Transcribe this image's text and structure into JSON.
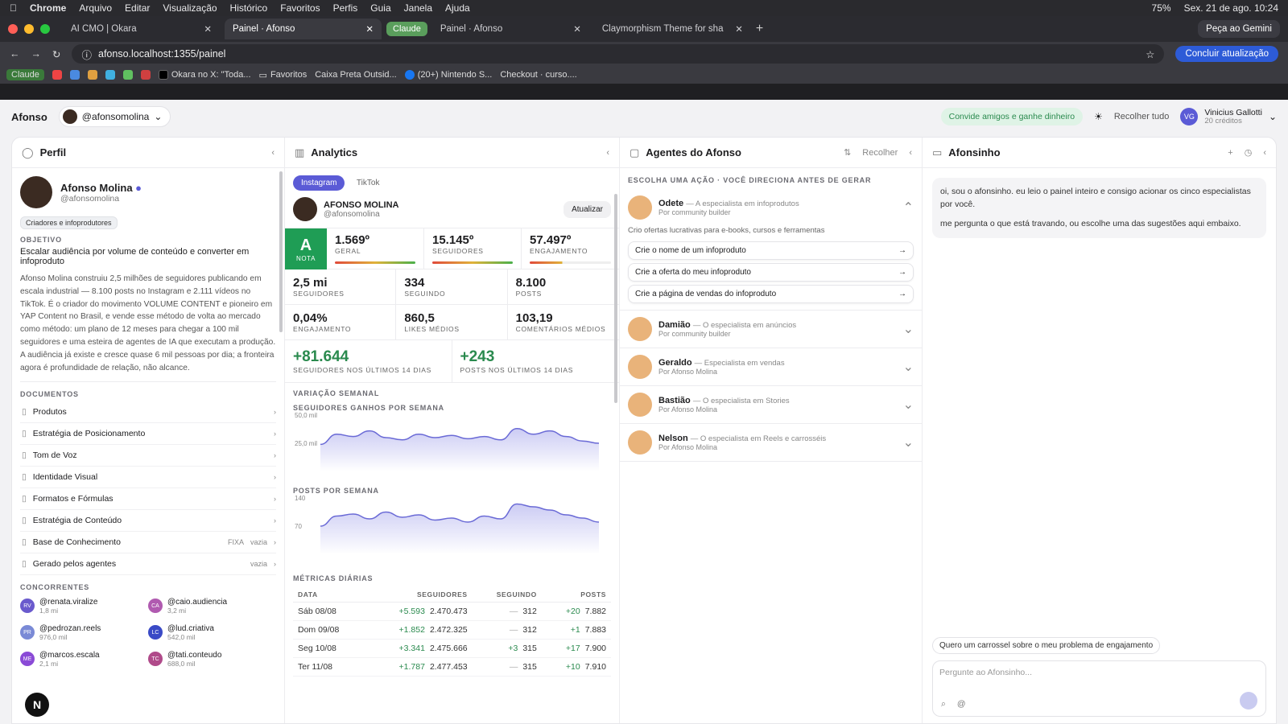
{
  "macbar": {
    "menus": [
      "Chrome",
      "Arquivo",
      "Editar",
      "Visualização",
      "Histórico",
      "Favoritos",
      "Perfis",
      "Guia",
      "Janela",
      "Ajuda"
    ],
    "battery": "75%",
    "datetime": "Sex. 21 de ago.  10:24"
  },
  "tabs": [
    {
      "title": "AI CMO | Okara"
    },
    {
      "title": "Painel · Afonso",
      "active": true
    },
    {
      "group": "Claude"
    },
    {
      "title": "Painel · Afonso"
    },
    {
      "title": "Claymorphism Theme for sha"
    }
  ],
  "gemini": "Peça ao Gemini",
  "url": "afonso.localhost:1355/painel",
  "update_btn": "Concluir atualização",
  "bookmarks": [
    "Claude",
    "Okara no X: \"Toda...",
    "Favoritos",
    "Caixa Preta Outsid...",
    "(20+) Nintendo S...",
    "Checkout · curso...."
  ],
  "app": {
    "brand": "Afonso",
    "account": "@afonsomolina",
    "invite": "Convide amigos e ganhe dinheiro",
    "collapse_all": "Recolher tudo",
    "user_name": "Vinicius Gallotti",
    "user_credits": "20 créditos",
    "user_initials": "VG"
  },
  "profile": {
    "title": "Perfil",
    "name": "Afonso Molina",
    "handle": "@afonsomolina",
    "badge": "Criadores e infoprodutores",
    "objective_label": "OBJETIVO",
    "objective": "Escalar audiência por volume de conteúdo e converter em infoproduto",
    "bio": "Afonso Molina construiu 2,5 milhões de seguidores publicando em escala industrial — 8.100 posts no Instagram e 2.111 vídeos no TikTok. É o criador do movimento VOLUME CONTENT e pioneiro em YAP Content no Brasil, e vende esse método de volta ao mercado como método: um plano de 12 meses para chegar a 100 mil seguidores e uma esteira de agentes de IA que executam a produção. A audiência já existe e cresce quase 6 mil pessoas por dia; a fronteira agora é profundidade de relação, não alcance.",
    "docs_label": "DOCUMENTOS",
    "docs": [
      {
        "name": "Produtos"
      },
      {
        "name": "Estratégia de Posicionamento"
      },
      {
        "name": "Tom de Voz"
      },
      {
        "name": "Identidade Visual"
      },
      {
        "name": "Formatos e Fórmulas"
      },
      {
        "name": "Estratégia de Conteúdo"
      },
      {
        "name": "Base de Conhecimento",
        "tag": "FIXA",
        "status": "vazia"
      },
      {
        "name": "Gerado pelos agentes",
        "status": "vazia"
      }
    ],
    "comp_label": "CONCORRENTES",
    "competitors": [
      {
        "handle": "@renata.viralize",
        "count": "1,8 mi",
        "initials": "RV",
        "color": "#6a5acd"
      },
      {
        "handle": "@caio.audiencia",
        "count": "3,2 mi",
        "initials": "CA",
        "color": "#b05ab0"
      },
      {
        "handle": "@pedrozan.reels",
        "count": "976,0 mil",
        "initials": "PR",
        "color": "#7a8ad6"
      },
      {
        "handle": "@lud.criativa",
        "count": "542,0 mil",
        "initials": "LC",
        "color": "#3a4ac6"
      },
      {
        "handle": "@marcos.escala",
        "count": "2,1 mi",
        "initials": "ME",
        "color": "#8a4ad6"
      },
      {
        "handle": "@tati.conteudo",
        "count": "688,0 mil",
        "initials": "TC",
        "color": "#b04a8a"
      }
    ]
  },
  "analytics": {
    "title": "Analytics",
    "tab_on": "Instagram",
    "tab_off": "TikTok",
    "acct_name": "AFONSO MOLINA",
    "acct_handle": "@afonsomolina",
    "refresh": "Atualizar",
    "grade": "A",
    "grade_label": "NOTA",
    "ranks": [
      {
        "v": "1.569º",
        "l": "GERAL"
      },
      {
        "v": "15.145º",
        "l": "SEGUIDORES"
      },
      {
        "v": "57.497º",
        "l": "ENGAJAMENTO"
      }
    ],
    "stats": [
      {
        "v": "2,5 mi",
        "l": "SEGUIDORES"
      },
      {
        "v": "334",
        "l": "SEGUINDO"
      },
      {
        "v": "8.100",
        "l": "POSTS"
      },
      {
        "v": "0,04%",
        "l": "ENGAJAMENTO"
      },
      {
        "v": "860,5",
        "l": "LIKES MÉDIOS"
      },
      {
        "v": "103,19",
        "l": "COMENTÁRIOS MÉDIOS"
      }
    ],
    "growth": [
      {
        "v": "+81.644",
        "l": "SEGUIDORES NOS ÚLTIMOS 14 DIAS"
      },
      {
        "v": "+243",
        "l": "POSTS NOS ÚLTIMOS 14 DIAS"
      }
    ],
    "weekly_label": "VARIAÇÃO SEMANAL",
    "daily_label": "MÉTRICAS DIÁRIAS",
    "table_headers": [
      "DATA",
      "SEGUIDORES",
      "SEGUINDO",
      "POSTS"
    ],
    "rows": [
      {
        "d": "Sáb 08/08",
        "sd": "+5.593",
        "s": "2.470.473",
        "gd": "—",
        "g": "312",
        "pd": "+20",
        "p": "7.882"
      },
      {
        "d": "Dom 09/08",
        "sd": "+1.852",
        "s": "2.472.325",
        "gd": "—",
        "g": "312",
        "pd": "+1",
        "p": "7.883"
      },
      {
        "d": "Seg 10/08",
        "sd": "+3.341",
        "s": "2.475.666",
        "gd": "+3",
        "g": "315",
        "pd": "+17",
        "p": "7.900"
      },
      {
        "d": "Ter 11/08",
        "sd": "+1.787",
        "s": "2.477.453",
        "gd": "—",
        "g": "315",
        "pd": "+10",
        "p": "7.910"
      }
    ]
  },
  "chart_data": [
    {
      "type": "area",
      "title": "SEGUIDORES GANHOS POR SEMANA",
      "ytick_labels": [
        "50,0 mil",
        "25,0 mil"
      ],
      "ylim": [
        0,
        50
      ],
      "values": [
        24,
        33,
        31,
        36,
        30,
        28,
        33,
        30,
        32,
        29,
        31,
        28,
        38,
        33,
        36,
        31,
        27,
        25
      ]
    },
    {
      "type": "area",
      "title": "POSTS POR SEMANA",
      "ytick_labels": [
        "140",
        "70"
      ],
      "ylim": [
        0,
        140
      ],
      "values": [
        70,
        95,
        100,
        88,
        105,
        92,
        98,
        85,
        90,
        80,
        95,
        88,
        125,
        118,
        110,
        98,
        90,
        80
      ]
    }
  ],
  "agents": {
    "title": "Agentes do Afonso",
    "collapse": "Recolher",
    "action_label": "ESCOLHA UMA AÇÃO · VOCÊ DIRECIONA ANTES DE GERAR",
    "intro": "Crio ofertas lucrativas para e-books, cursos e ferramentas",
    "suggestions": [
      "Crie o nome de um infoproduto",
      "Crie a oferta do meu infoproduto",
      "Crie a página de vendas do infoproduto"
    ],
    "list": [
      {
        "name": "Odete",
        "role": "— A especialista em infoprodutos",
        "by": "Por community builder"
      },
      {
        "name": "Damião",
        "role": "— O especialista em anúncios",
        "by": "Por community builder"
      },
      {
        "name": "Geraldo",
        "role": "— Especialista em vendas",
        "by": "Por Afonso Molina"
      },
      {
        "name": "Bastião",
        "role": "— O especialista em Stories",
        "by": "Por Afonso Molina"
      },
      {
        "name": "Nelson",
        "role": "— O especialista em Reels e carrosséis",
        "by": "Por Afonso Molina"
      }
    ]
  },
  "chat": {
    "title": "Afonsinho",
    "msg1": "oi, sou o afonsinho. eu leio o painel inteiro e consigo acionar os cinco especialistas por você.",
    "msg2": "me pergunta o que está travando, ou escolhe uma das sugestões aqui embaixo.",
    "chip": "Quero um carrossel sobre o meu problema de engajamento",
    "placeholder": "Pergunte ao Afonsinho..."
  }
}
